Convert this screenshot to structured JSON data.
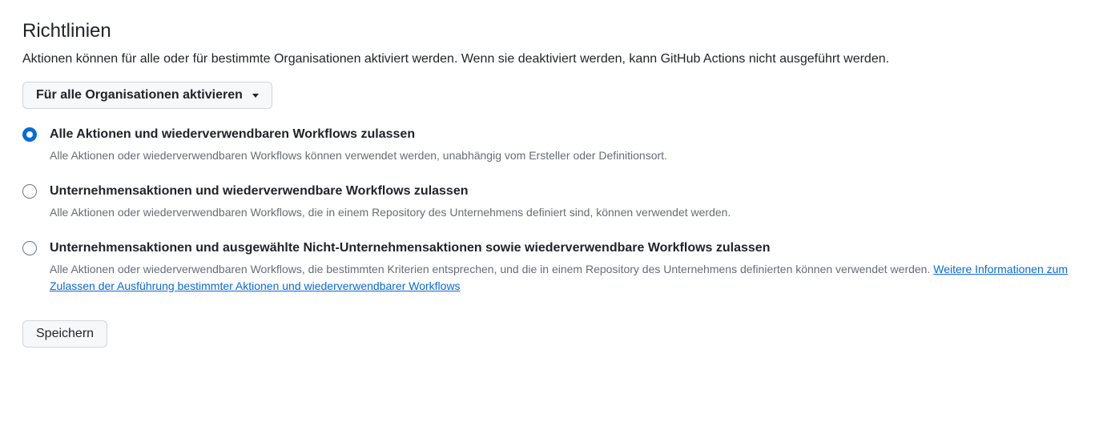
{
  "title": "Richtlinien",
  "description": "Aktionen können für alle oder für bestimmte Organisationen aktiviert werden. Wenn sie deaktiviert werden, kann GitHub Actions nicht ausgeführt werden.",
  "dropdown": {
    "selected": "Für alle Organisationen aktivieren"
  },
  "options": [
    {
      "label": "Alle Aktionen und wiederverwendbaren Workflows zulassen",
      "desc": "Alle Aktionen oder wiederverwendbaren Workflows können verwendet werden, unabhängig vom Ersteller oder Definitionsort.",
      "checked": true
    },
    {
      "label": "Unternehmensaktionen und wiederverwendbare Workflows zulassen",
      "desc": "Alle Aktionen oder wiederverwendbaren Workflows, die in einem Repository des Unternehmens definiert sind, können verwendet werden.",
      "checked": false
    },
    {
      "label": "Unternehmensaktionen und ausgewählte Nicht-Unternehmensaktionen sowie wiederverwendbare Workflows zulassen",
      "desc_prefix": "Alle Aktionen oder wiederverwendbaren Workflows, die bestimmten Kriterien entsprechen, und die in einem Repository des Unternehmens definierten können verwendet werden. ",
      "link_text": "Weitere Informationen zum Zulassen der Ausführung bestimmter Aktionen und wiederverwendbarer Workflows",
      "checked": false
    }
  ],
  "save_label": "Speichern"
}
